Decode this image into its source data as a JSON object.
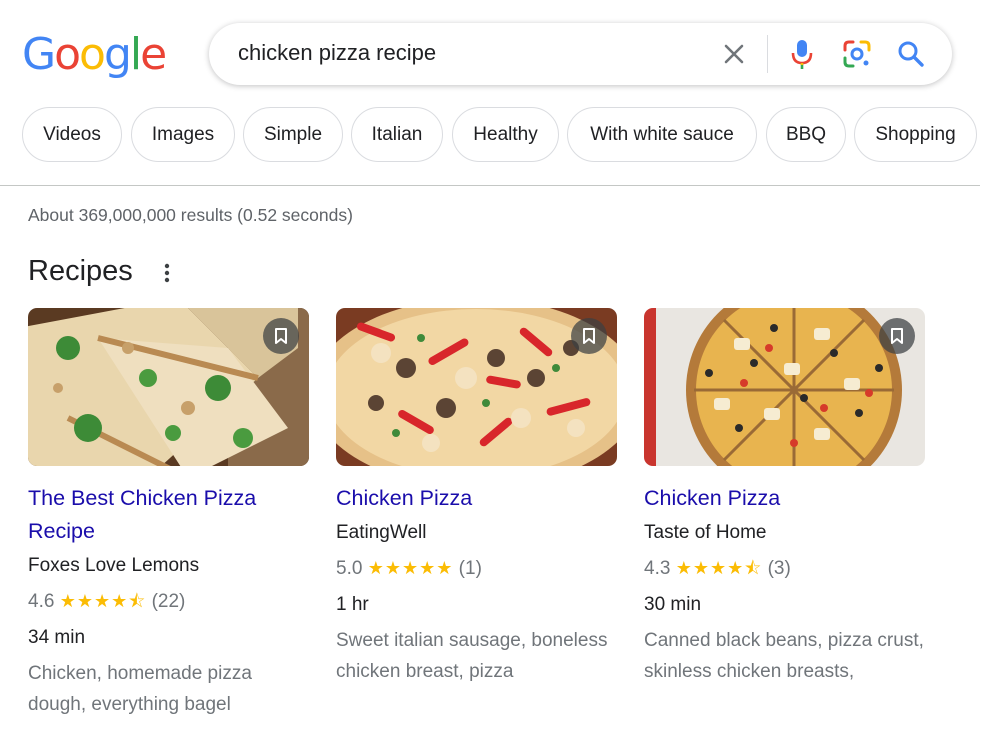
{
  "logo": {
    "letters": [
      {
        "char": "G",
        "color": "#4285F4"
      },
      {
        "char": "o",
        "color": "#EA4335"
      },
      {
        "char": "o",
        "color": "#FBBC05"
      },
      {
        "char": "g",
        "color": "#4285F4"
      },
      {
        "char": "l",
        "color": "#34A853"
      },
      {
        "char": "e",
        "color": "#EA4335"
      }
    ]
  },
  "search": {
    "query": "chicken pizza recipe",
    "icons": [
      "close-icon",
      "microphone-icon",
      "lens-icon",
      "search-icon"
    ]
  },
  "chips": [
    "Videos",
    "Images",
    "Simple",
    "Italian",
    "Healthy",
    "With white sauce",
    "BBQ",
    "Shopping"
  ],
  "stats": "About 369,000,000 results (0.52 seconds)",
  "recipes": {
    "title": "Recipes",
    "cards": [
      {
        "title": "The Best Chicken Pizza Recipe",
        "source": "Foxes Love Lemons",
        "rating": "4.6",
        "stars": 4.6,
        "count": "(22)",
        "time": "34 min",
        "ingredients": "Chicken, homemade pizza dough, everything bagel"
      },
      {
        "title": "Chicken Pizza",
        "source": "EatingWell",
        "rating": "5.0",
        "stars": 5.0,
        "count": "(1)",
        "time": "1 hr",
        "ingredients": "Sweet italian sausage, boneless chicken breast, pizza"
      },
      {
        "title": "Chicken Pizza",
        "source": "Taste of Home",
        "rating": "4.3",
        "stars": 4.3,
        "count": "(3)",
        "time": "30 min",
        "ingredients": "Canned black beans, pizza crust, skinless chicken breasts,"
      }
    ]
  },
  "colors": {
    "link": "#1a0dab",
    "star": "#fbbc04",
    "muted": "#70757a"
  }
}
